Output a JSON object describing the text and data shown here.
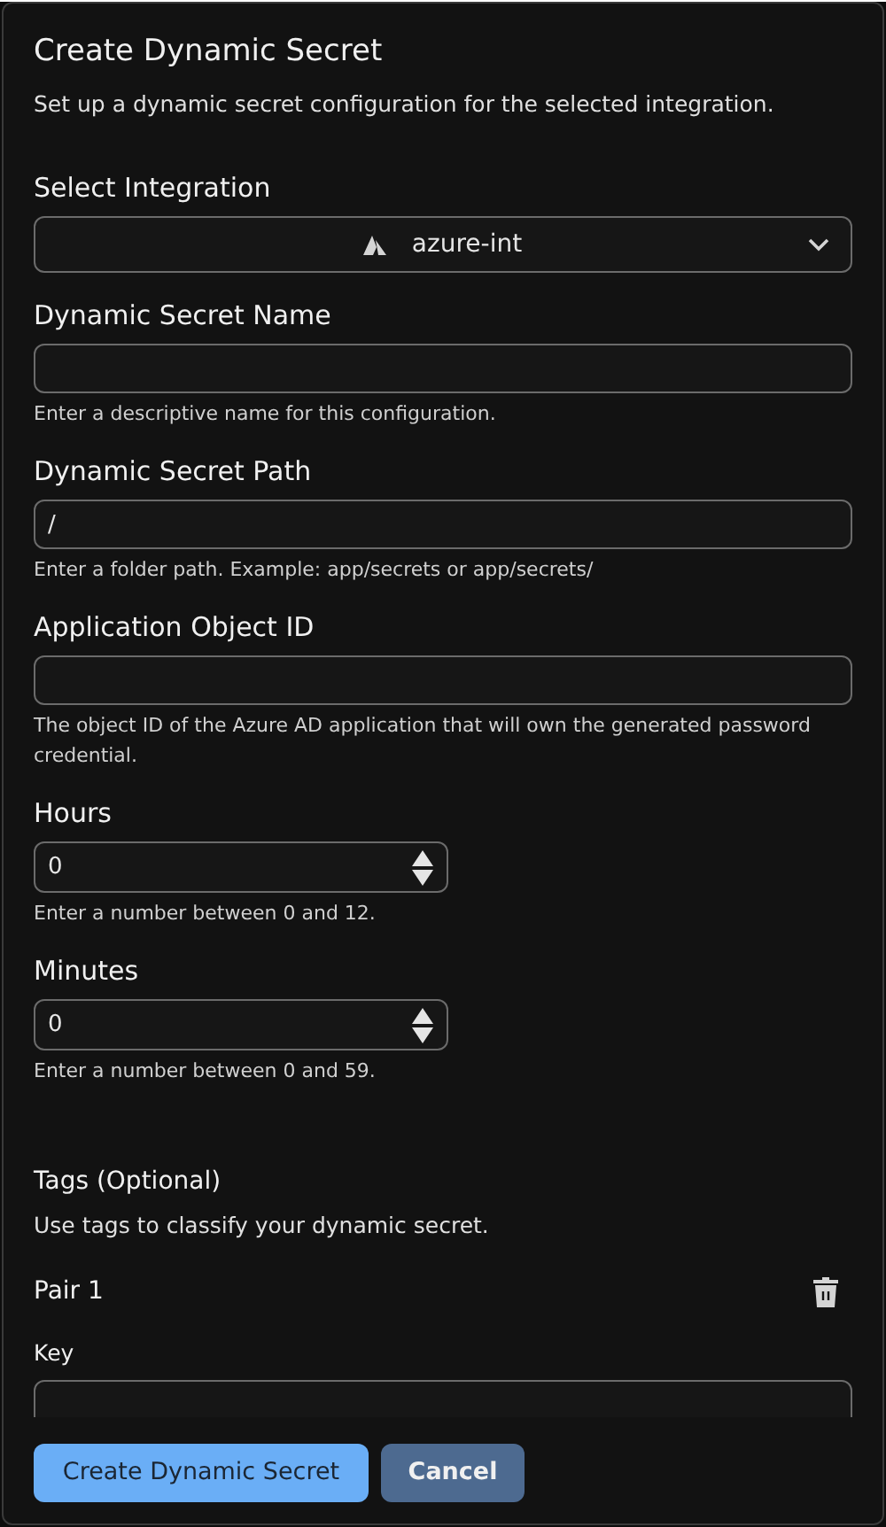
{
  "dialog": {
    "title": "Create Dynamic Secret",
    "description": "Set up a dynamic secret configuration for the selected integration."
  },
  "fields": [
    {
      "kind": "select",
      "label": "Select Integration",
      "value": "azure-int"
    },
    {
      "kind": "text",
      "label": "Dynamic Secret Name",
      "hint": "Enter a descriptive name for this configuration."
    },
    {
      "kind": "text",
      "label": "Dynamic Secret Path",
      "value": "/",
      "hint": "Enter a folder path. Example: app/secrets or app/secrets/"
    },
    {
      "kind": "text",
      "label": "Application Object ID",
      "hint": "The object ID of the Azure AD application that will own the generated password credential."
    },
    {
      "kind": "number",
      "label": "Hours",
      "value": "0",
      "hint": "Enter a number between 0 and 12."
    },
    {
      "kind": "number",
      "label": "Minutes",
      "value": "0",
      "hint": "Enter a number between 0 and 59."
    }
  ],
  "tags": {
    "title": "Tags (Optional)",
    "description": "Use tags to classify your dynamic secret.",
    "pairs": [
      {
        "title": "Pair 1",
        "key_label": "Key"
      }
    ]
  },
  "buttons": [
    {
      "label": "Create Dynamic Secret",
      "kind": "primary"
    },
    {
      "label": "Cancel",
      "kind": "secondary"
    }
  ]
}
